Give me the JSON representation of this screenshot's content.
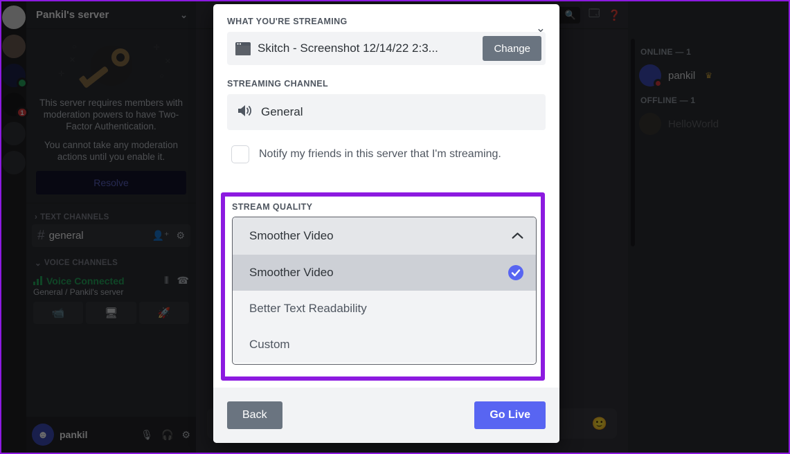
{
  "background": {
    "server_name": "Pankil's server",
    "twofa": {
      "line1": "This server requires members with moderation powers to have Two-Factor Authentication.",
      "line2": "You cannot take any moderation actions until you enable it.",
      "resolve_label": "Resolve"
    },
    "text_channels_header": "TEXT CHANNELS",
    "text_channel": "general",
    "voice_channels_header": "VOICE CHANNELS",
    "voice_connected_title": "Voice Connected",
    "voice_connected_sub": "General / Pankil's server",
    "user_name": "pankil",
    "search_placeholder": "Search",
    "members": {
      "online_header": "ONLINE — 1",
      "online": [
        {
          "name": "pankil",
          "owner": true
        }
      ],
      "offline_header": "OFFLINE — 1",
      "offline": [
        {
          "name": "HelloWorld"
        }
      ]
    },
    "server_badges": {
      "unread_count": "1"
    }
  },
  "modal": {
    "what_streaming_label": "WHAT YOU'RE STREAMING",
    "source_title": "Skitch - Screenshot 12/14/22 2:3...",
    "change_label": "Change",
    "streaming_channel_label": "STREAMING CHANNEL",
    "streaming_channel_value": "General",
    "notify_label": "Notify my friends in this server that I'm streaming.",
    "notify_checked": false,
    "stream_quality_label": "STREAM QUALITY",
    "stream_quality_selected": "Smoother Video",
    "stream_quality_options": [
      {
        "label": "Smoother Video",
        "selected": true
      },
      {
        "label": "Better Text Readability",
        "selected": false
      },
      {
        "label": "Custom",
        "selected": false
      }
    ],
    "back_label": "Back",
    "golive_label": "Go Live"
  },
  "colors": {
    "annotation": "#8c1ae0",
    "accent": "#5865f2",
    "neutral_button": "#6a7480",
    "online_green": "#23a55a"
  }
}
